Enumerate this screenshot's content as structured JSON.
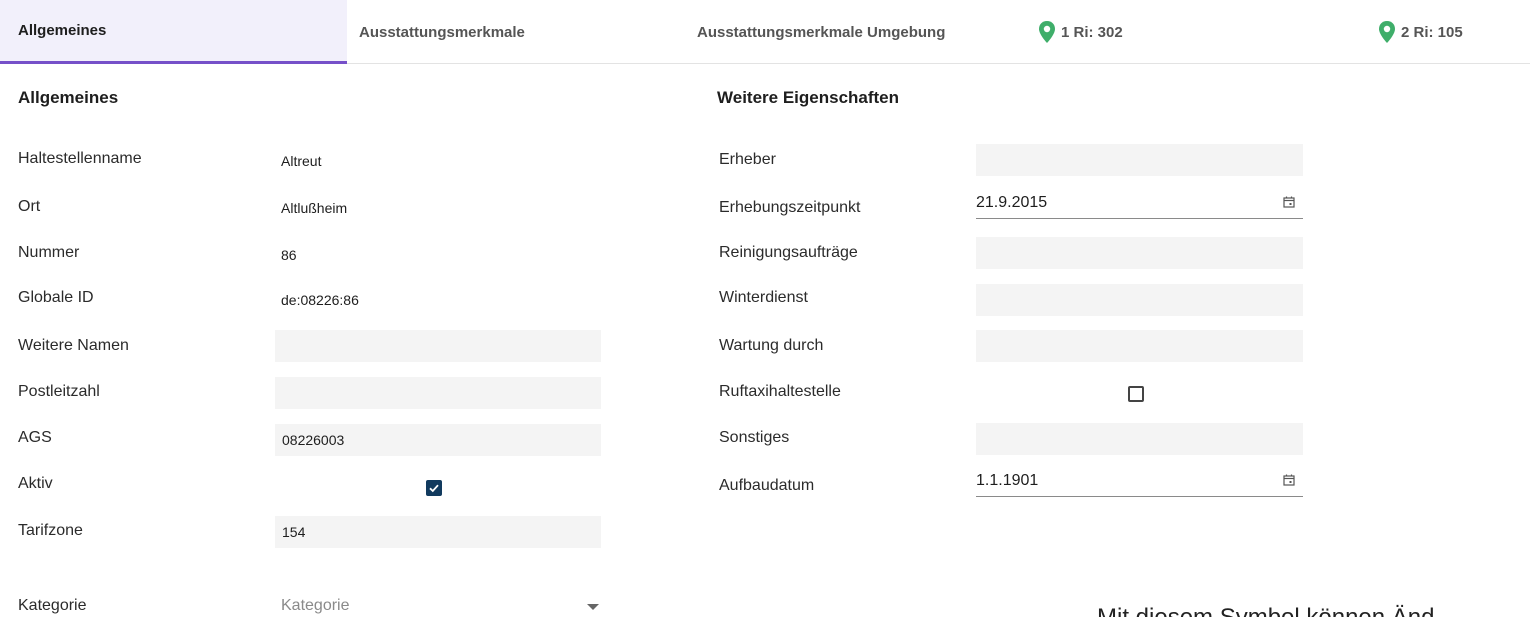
{
  "tabs": [
    {
      "label": "Allgemeines",
      "active": true
    },
    {
      "label": "Ausstattungsmerkmale",
      "active": false
    },
    {
      "label": "Ausstattungsmerkmale Umgebung",
      "active": false
    },
    {
      "label": "1 Ri: 302",
      "active": false,
      "icon": "map-pin-icon"
    },
    {
      "label": "2 Ri: 105",
      "active": false,
      "icon": "map-pin-icon"
    }
  ],
  "colors": {
    "accent": "#7650c9",
    "pin": "#3fae6a",
    "checkbox": "#113a5e"
  },
  "left": {
    "title": "Allgemeines",
    "haltestellenname": {
      "label": "Haltestellenname",
      "value": "Altreut"
    },
    "ort": {
      "label": "Ort",
      "value": "Altlußheim"
    },
    "nummer": {
      "label": "Nummer",
      "value": "86"
    },
    "globale_id": {
      "label": "Globale ID",
      "value": "de:08226:86"
    },
    "weitere_namen": {
      "label": "Weitere Namen",
      "value": ""
    },
    "postleitzahl": {
      "label": "Postleitzahl",
      "value": ""
    },
    "ags": {
      "label": "AGS",
      "value": "08226003"
    },
    "aktiv": {
      "label": "Aktiv",
      "checked": true
    },
    "tarifzone": {
      "label": "Tarifzone",
      "value": "154"
    },
    "kategorie": {
      "label": "Kategorie",
      "placeholder": "Kategorie"
    }
  },
  "right": {
    "title": "Weitere Eigenschaften",
    "erheber": {
      "label": "Erheber",
      "value": ""
    },
    "erhebungszeitpunkt": {
      "label": "Erhebungszeitpunkt",
      "value": "21.9.2015"
    },
    "reinigungsauftraege": {
      "label": "Reinigungsaufträge",
      "value": ""
    },
    "winterdienst": {
      "label": "Winterdienst",
      "value": ""
    },
    "wartung": {
      "label": "Wartung durch",
      "value": ""
    },
    "ruftaxi": {
      "label": "Ruftaxihaltestelle",
      "checked": false
    },
    "sonstiges": {
      "label": "Sonstiges",
      "value": ""
    },
    "aufbaudatum": {
      "label": "Aufbaudatum",
      "value": "1.1.1901"
    }
  },
  "footer": {
    "text": "Mit diesem Symbol können Änd"
  }
}
